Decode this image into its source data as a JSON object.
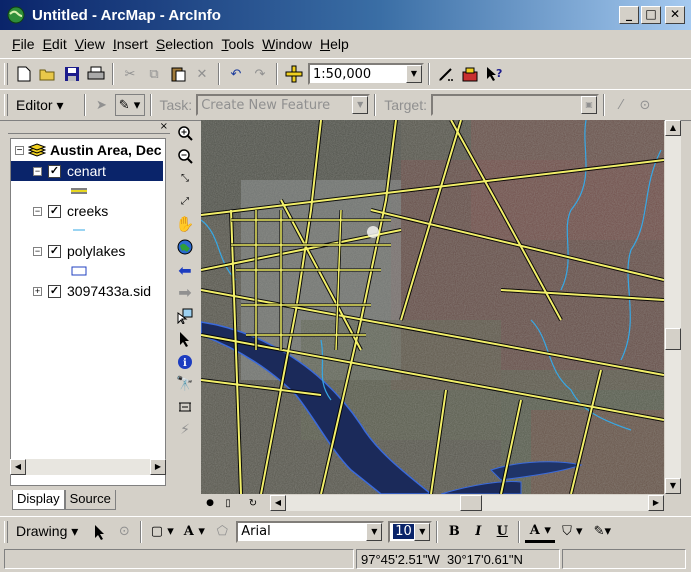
{
  "window": {
    "title": "Untitled - ArcMap - ArcInfo",
    "minimize": "_",
    "maximize": "□",
    "close": "✕"
  },
  "menu": [
    {
      "u": "F",
      "rest": "ile"
    },
    {
      "u": "E",
      "rest": "dit"
    },
    {
      "u": "V",
      "rest": "iew"
    },
    {
      "u": "I",
      "rest": "nsert"
    },
    {
      "u": "S",
      "rest": "election"
    },
    {
      "u": "T",
      "rest": "ools"
    },
    {
      "u": "W",
      "rest": "indow"
    },
    {
      "u": "H",
      "rest": "elp"
    }
  ],
  "standard_toolbar": {
    "scale": "1:50,000"
  },
  "editor_toolbar": {
    "editor_label": "Editor ▾",
    "task_label": "Task:",
    "task_value": "Create New Feature",
    "target_label": "Target:"
  },
  "toc": {
    "data_frame": "Austin Area, Dec",
    "layers": [
      {
        "name": "cenart",
        "expander": "−",
        "check": "✓"
      },
      {
        "name": "creeks",
        "expander": "−",
        "check": "✓"
      },
      {
        "name": "polylakes",
        "expander": "−",
        "check": "✓"
      },
      {
        "name": "3097433a.sid",
        "expander": "+",
        "check": "✓"
      }
    ],
    "tabs": [
      "Display",
      "Source"
    ],
    "close": "×"
  },
  "drawing_toolbar": {
    "drawing_label": "Drawing ▾",
    "font": "Arial",
    "size": "10",
    "bold": "B",
    "italic": "I",
    "underline": "U"
  },
  "status": {
    "coordinates": "97°45'2.51\"W  30°17'0.61\"N"
  },
  "colors": {
    "roads": "#f2ef6a",
    "creeks": "#36a8e6",
    "water": "#1b2a5a",
    "title_start": "#0a246a"
  },
  "icons": [
    "new-icon",
    "open-icon",
    "save-icon",
    "print-icon",
    "cut-icon",
    "copy-icon",
    "paste-icon",
    "delete-icon",
    "undo-icon",
    "redo-icon",
    "add-data-icon",
    "editor-icon",
    "arctoolbox-icon",
    "whats-this-icon",
    "zoom-in-icon",
    "zoom-out-icon",
    "fixed-zoom-in-icon",
    "fixed-zoom-out-icon",
    "pan-icon",
    "full-extent-icon",
    "back-icon",
    "forward-icon",
    "select-features-icon",
    "select-elements-icon",
    "identify-icon",
    "find-icon",
    "measure-icon",
    "hyperlink-icon"
  ]
}
